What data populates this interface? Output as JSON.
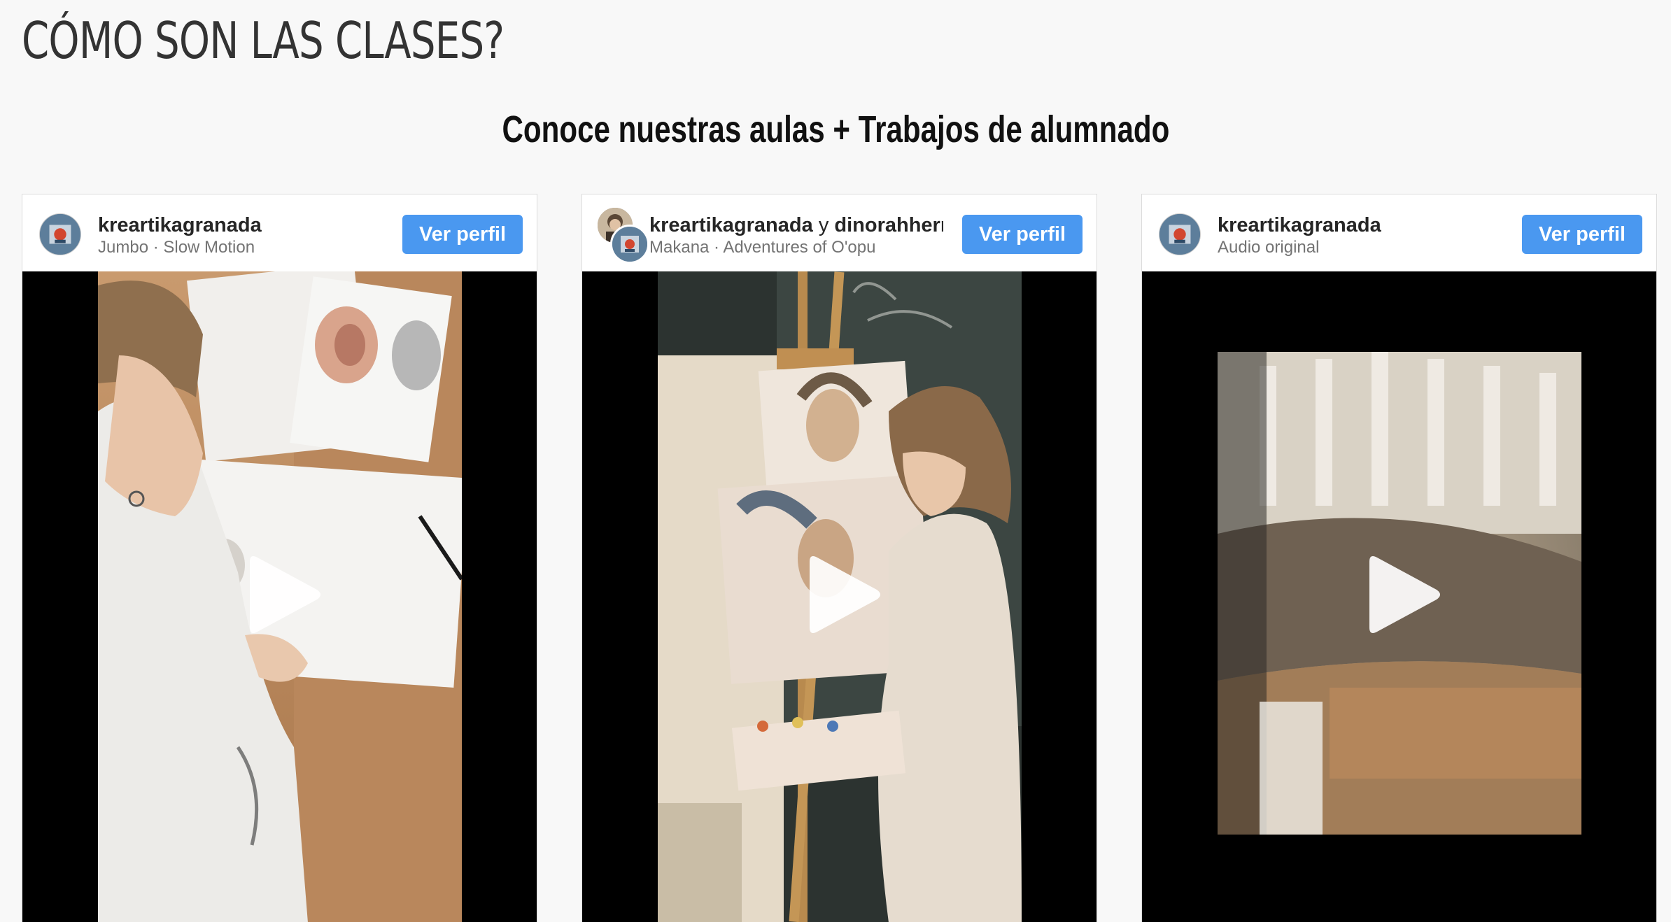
{
  "page": {
    "title": "CÓMO SON LAS CLASES?",
    "subtitle": "Conoce nuestras aulas + Trabajos de alumnado"
  },
  "posts": [
    {
      "username": "kreartikagranada",
      "audio": "Jumbo · Slow Motion",
      "button_label": "Ver perfil",
      "video_scene": "drawing-lesson"
    },
    {
      "username": "kreartikagranada",
      "joiner": "y",
      "collaborator": "dinorahhern",
      "audio": "Makana · Adventures of O'opu",
      "button_label": "Ver perfil",
      "video_scene": "painting-at-easel"
    },
    {
      "username": "kreartikagranada",
      "audio": "Audio original",
      "button_label": "Ver perfil",
      "video_scene": "blurred-classroom"
    }
  ],
  "colors": {
    "button": "#4a98f0",
    "background": "#f8f8f8",
    "video_background": "#000000"
  },
  "icons": [
    "play-icon",
    "avatar-logo-icon"
  ]
}
